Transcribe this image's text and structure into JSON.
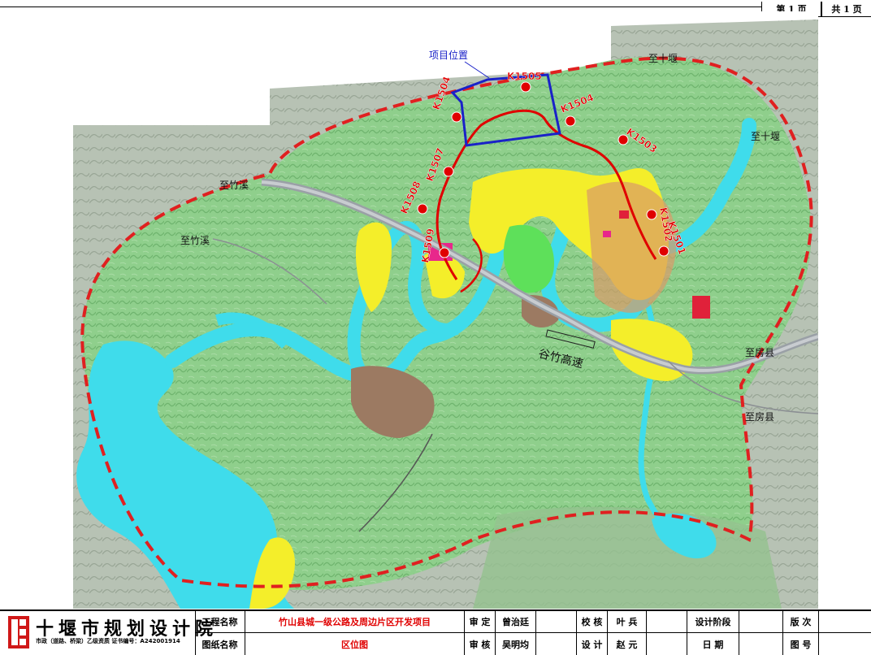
{
  "header": {
    "page_no": "第 1 页",
    "page_total": "共 1 页"
  },
  "map": {
    "project_location_label": "项目位置",
    "stations": [
      "K1505",
      "K1504",
      "K1504",
      "K1503",
      "K1502",
      "K1501",
      "K1507",
      "K1508",
      "K1509"
    ],
    "directions": {
      "to_shiyan_top": "至十堰",
      "to_shiyan_right": "至十堰",
      "to_zhuxi_1": "至竹溪",
      "to_zhuxi_2": "至竹溪",
      "to_fangxian_1": "至房县",
      "to_fangxian_2": "至房县"
    },
    "expressway_label": "谷竹高速",
    "colors": {
      "boundary": "#e02020",
      "route": "#e00000",
      "project_box": "#1a22c8",
      "river": "#3fdceb",
      "hills": "#8fcf8c",
      "urban_yellow": "#f4ee2a",
      "urban_brown": "#9c7a62",
      "park_green": "#5ee05a"
    }
  },
  "title_block": {
    "institute": "十堰市规划设计院",
    "institute_sub": "市政（道路、桥梁）乙级资质    证书编号：A242001914",
    "project_name_label": "工程名称",
    "project_name": "竹山县城一级公路及周边片区开发项目",
    "drawing_name_label": "图纸名称",
    "drawing_name": "区位图",
    "approve_label": "审 定",
    "approve_name": "曾治廷",
    "review_label": "审 核",
    "review_name": "吴明均",
    "check_label": "校 核",
    "check_name": "叶 兵",
    "design_label": "设 计",
    "design_name": "赵 元",
    "stage_label": "设计阶段",
    "date_label": "日    期",
    "version_label": "版 次",
    "drawing_no_label": "图 号"
  }
}
